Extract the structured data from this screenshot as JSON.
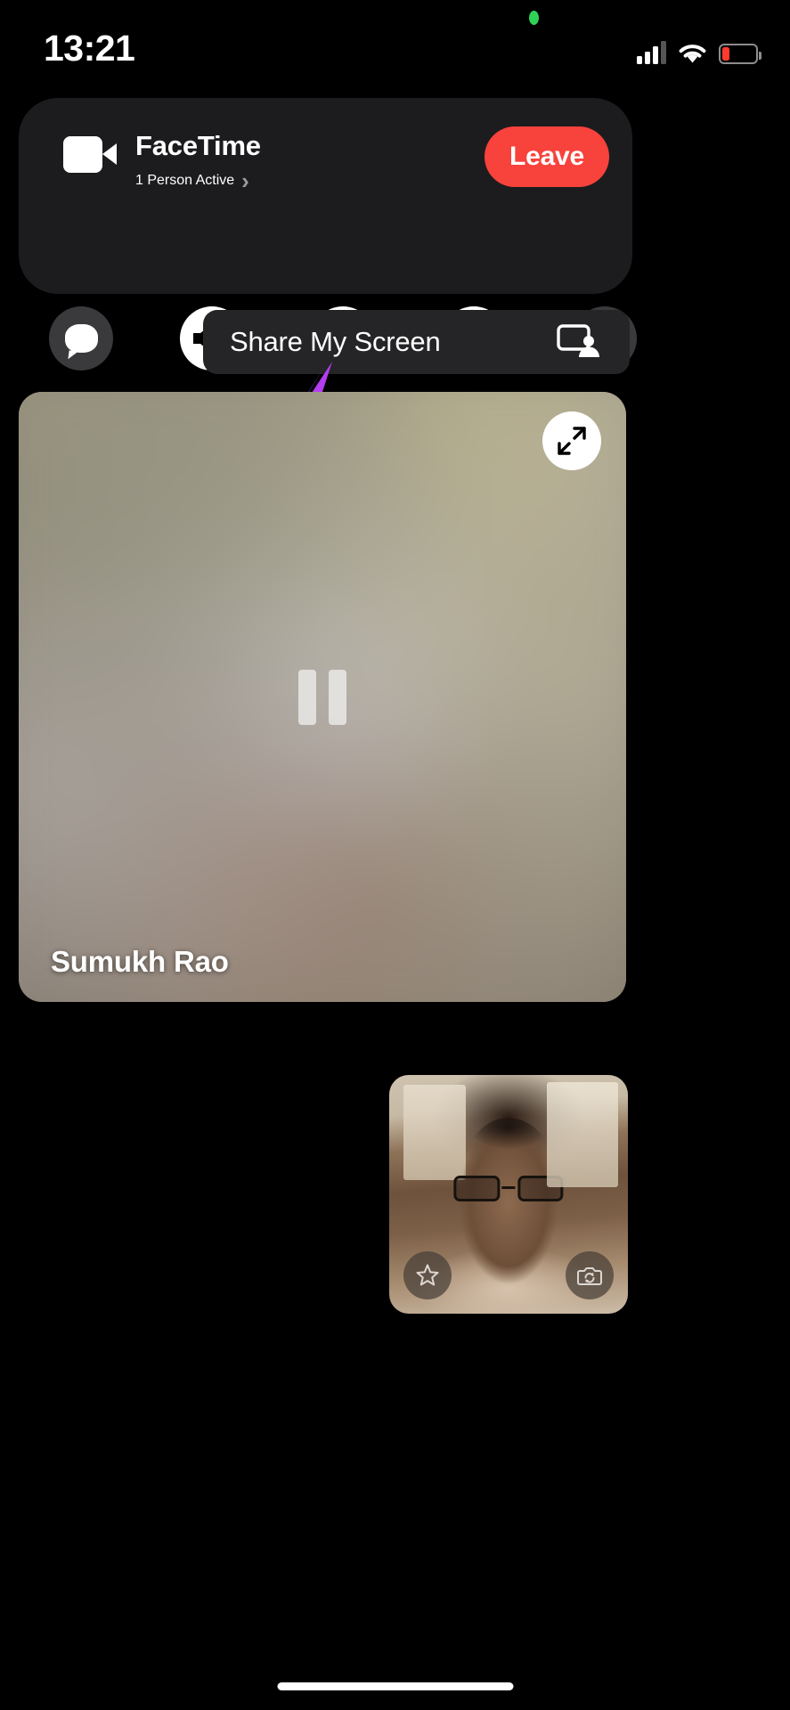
{
  "status_bar": {
    "time": "13:21",
    "green_indicator": "screen-recording-active",
    "icons": [
      "cellular-signal-icon",
      "wifi-icon",
      "battery-low-icon"
    ],
    "battery_state": "low",
    "battery_color": "#ff3b30"
  },
  "facetime_panel": {
    "app_icon": "video-camera-icon",
    "title": "FaceTime",
    "subtitle": "1 Person Active",
    "subtitle_chevron": "›",
    "leave_label": "Leave",
    "leave_color": "#f8423c",
    "background": "#1c1c1e"
  },
  "controls": [
    {
      "name": "messages-button",
      "icon": "chat-bubble-icon",
      "state": "inactive"
    },
    {
      "name": "speaker-button",
      "icon": "speaker-wave-icon",
      "state": "active"
    },
    {
      "name": "microphone-button",
      "icon": "microphone-icon",
      "state": "active"
    },
    {
      "name": "camera-button",
      "icon": "video-camera-icon",
      "state": "active"
    },
    {
      "name": "share-screen-button",
      "icon": "screen-share-icon",
      "state": "inactive"
    }
  ],
  "share_menu": {
    "item_label": "Share My Screen",
    "item_icon": "screen-share-icon",
    "background": "#252527"
  },
  "annotation": {
    "type": "arrow",
    "color": "#b43df0",
    "points_to": "Share My Screen"
  },
  "main_video": {
    "participant_name": "Sumukh Rao",
    "state": "paused",
    "pause_icon": "pause-icon",
    "expand_icon": "expand-arrows-icon"
  },
  "self_view": {
    "effects_icon": "sparkle-star-icon",
    "flip_icon": "camera-flip-icon"
  },
  "home_indicator": {
    "label": "home-indicator"
  }
}
